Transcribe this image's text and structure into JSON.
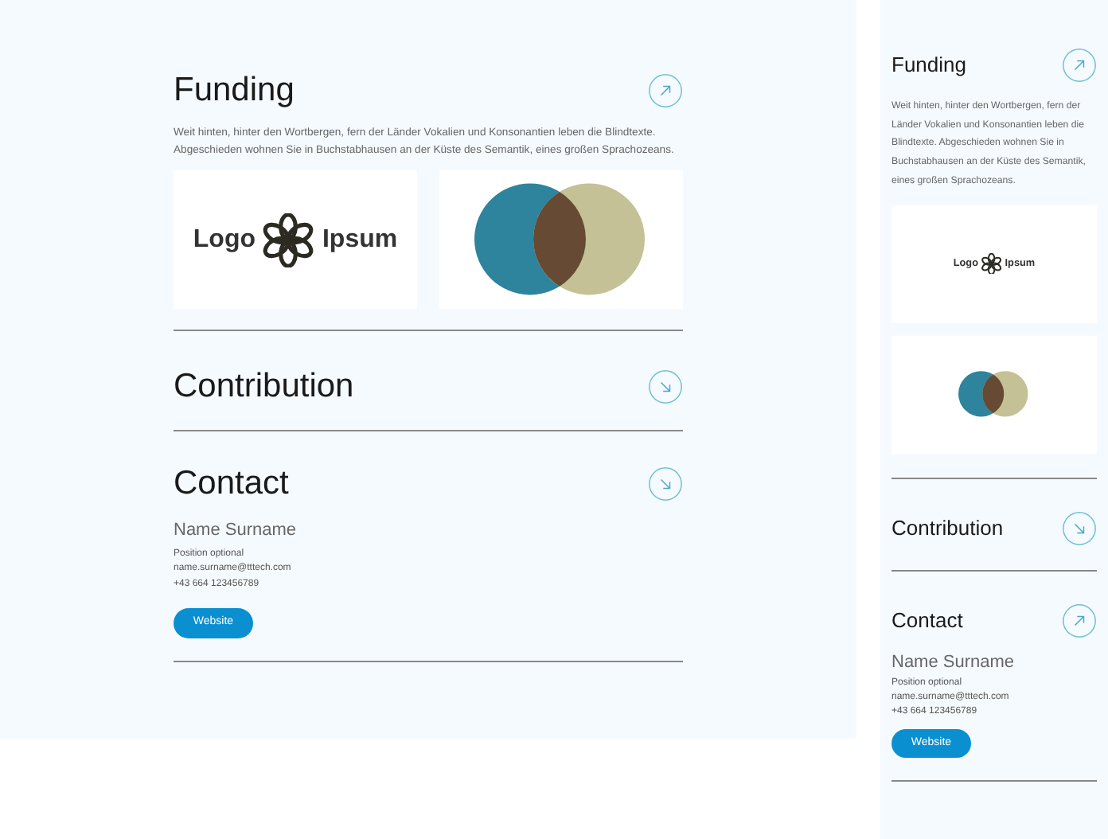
{
  "panels": [
    {
      "kind": "desktop",
      "sections": [
        {
          "title": "Funding",
          "kind": "up",
          "body": "Weit hinten, hinter den Wortbergen, fern der Länder Vokalien und Konsonantien leben die Blindtexte. Abgeschieden wohnen Sie in Buchstabhausen an der Küste des Semantik, eines großen Sprachozeans.",
          "logos": [
            {
              "kind": "wordmark",
              "words": [
                "Logo",
                "Ipsum"
              ]
            },
            {
              "kind": "venn"
            }
          ]
        },
        {
          "title": "Contribution",
          "kind": "down"
        },
        {
          "title": "Contact",
          "kind": "down",
          "contact": {
            "name": "Name Surname",
            "lines": [
              "Position optional",
              "name.surname@tttech.com",
              "+43 664 123456789"
            ],
            "button": "Website"
          }
        }
      ]
    },
    {
      "kind": "mobile",
      "sections": [
        {
          "title": "Funding",
          "kind": "up",
          "body": "Weit hinten, hinter den Wortbergen, fern der Länder Vokalien und Konsonantien leben die Blindtexte. Abgeschieden wohnen Sie in Buchstabhausen an der Küste des Semantik, eines großen Sprachozeans.",
          "logos": [
            {
              "kind": "wordmark",
              "words": [
                "Logo",
                "Ipsum"
              ]
            },
            {
              "kind": "venn"
            }
          ]
        },
        {
          "title": "Contribution",
          "kind": "down"
        },
        {
          "title": "Contact",
          "kind": "up",
          "contact": {
            "name": "Name Surname",
            "lines": [
              "Position optional",
              "name.surname@tttech.com",
              "+43 664 123456789"
            ],
            "button": "Website"
          }
        }
      ]
    }
  ]
}
